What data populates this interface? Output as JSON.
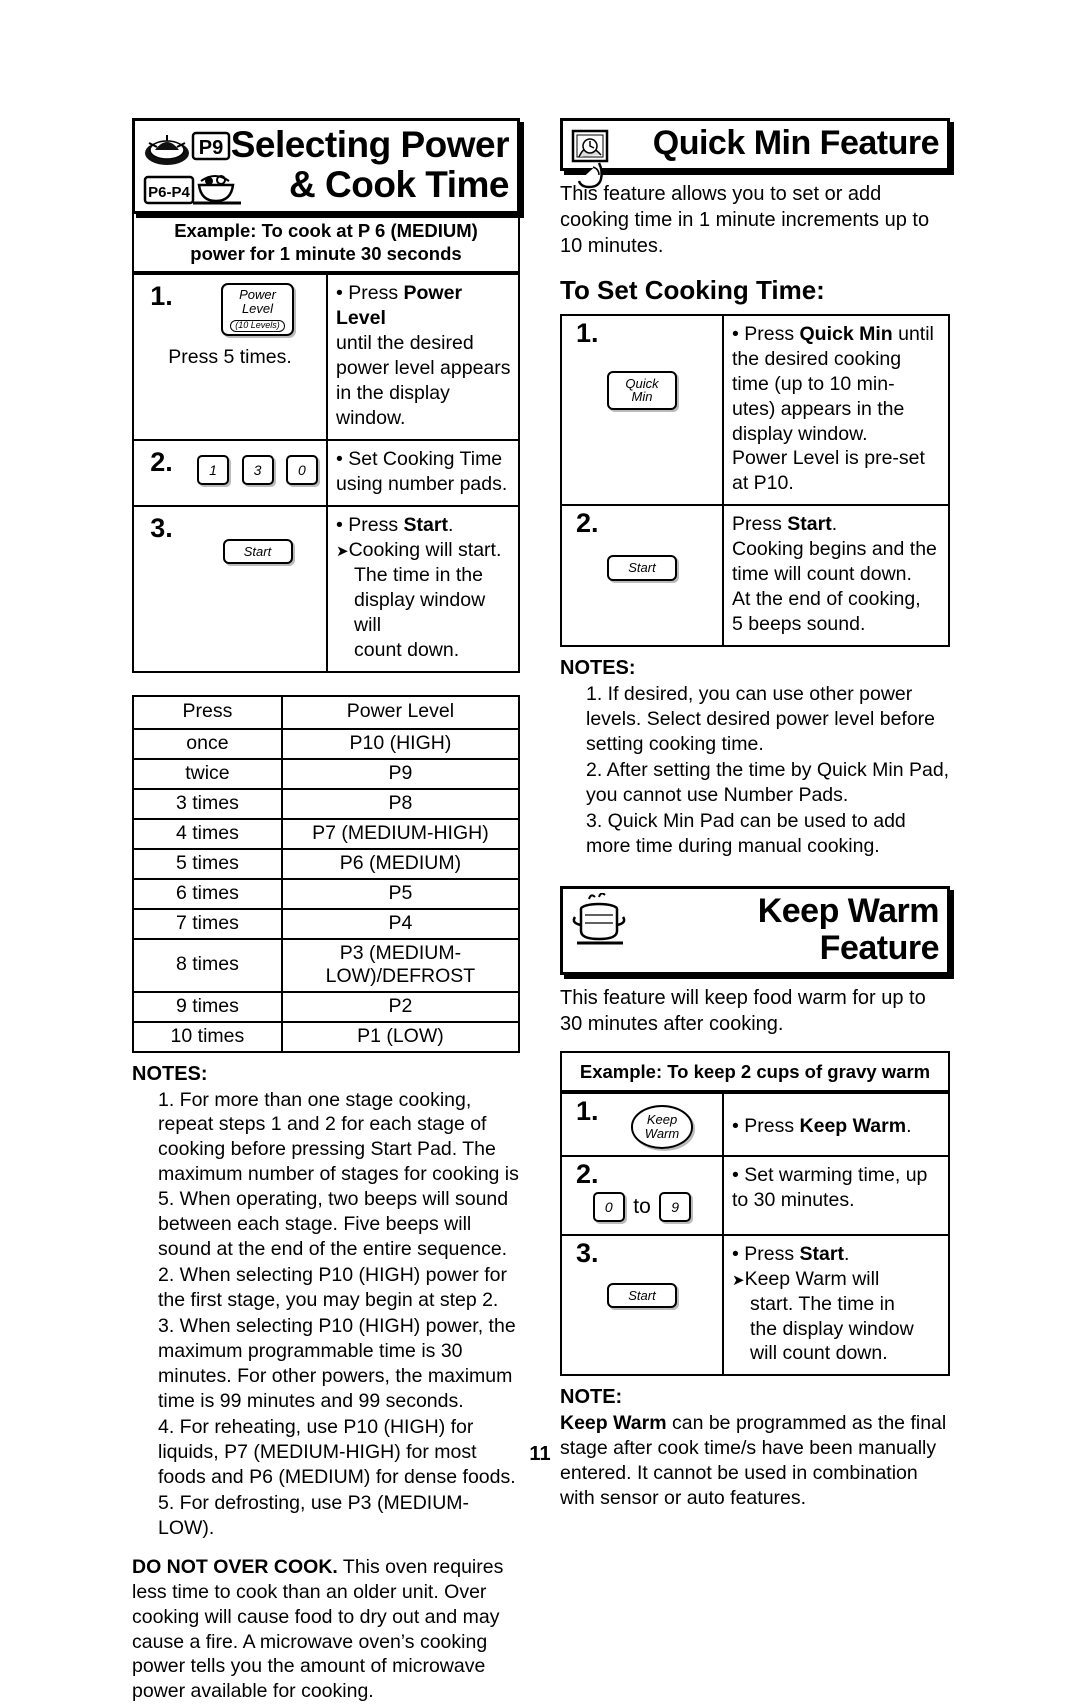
{
  "page_number": "11",
  "left": {
    "banner": {
      "line1": "Selecting Power",
      "line2": "& Cook Time",
      "icon_label_top": "P9",
      "icon_label_bottom": "P6-P4"
    },
    "example_header_line1": "Example: To cook at P 6 (MEDIUM)",
    "example_header_line2": "power for 1 minute 30 seconds",
    "steps": [
      {
        "number": "1.",
        "pad": {
          "kind": "power-level",
          "line1": "Power",
          "line2": "Level",
          "sub": "(10 Levels)"
        },
        "pad_caption": "Press 5 times.",
        "text": [
          {
            "style": "bullet",
            "parts": [
              "Press ",
              "Power Level"
            ]
          },
          {
            "style": "plain",
            "text": "until the desired"
          },
          {
            "style": "plain",
            "text": "power level appears"
          },
          {
            "style": "plain",
            "text": "in the display window."
          }
        ]
      },
      {
        "number": "2.",
        "pad": {
          "kind": "number-pads",
          "keys": [
            "1",
            "3",
            "0"
          ]
        },
        "text": [
          {
            "style": "bullet",
            "text": "Set Cooking Time"
          },
          {
            "style": "plain",
            "text": "using number pads."
          }
        ]
      },
      {
        "number": "3.",
        "pad": {
          "kind": "start",
          "label": "Start"
        },
        "text": [
          {
            "style": "bullet",
            "parts": [
              "Press ",
              "Start",
              "."
            ]
          },
          {
            "style": "arrow",
            "text": "Cooking will start."
          },
          {
            "style": "indent",
            "text": "The time in the"
          },
          {
            "style": "indent",
            "text": "display window will"
          },
          {
            "style": "indent",
            "text": "count down."
          }
        ]
      }
    ],
    "power_table": {
      "headers": [
        "Press",
        "Power Level"
      ],
      "rows": [
        [
          "once",
          "P10 (HIGH)"
        ],
        [
          "twice",
          "P9"
        ],
        [
          "3 times",
          "P8"
        ],
        [
          "4 times",
          "P7 (MEDIUM-HIGH)"
        ],
        [
          "5 times",
          "P6 (MEDIUM)"
        ],
        [
          "6 times",
          "P5"
        ],
        [
          "7 times",
          "P4"
        ],
        [
          "8 times",
          "P3 (MEDIUM-LOW)/DEFROST"
        ],
        [
          "9 times",
          "P2"
        ],
        [
          "10 times",
          "P1 (LOW)"
        ]
      ]
    },
    "notes_head": "NOTES:",
    "notes": [
      "1. For more than one stage cooking, repeat steps 1 and 2 for each stage of cooking before pressing Start Pad. The maximum number of stages for cooking is 5. When operating, two beeps will sound between each stage. Five beeps will sound at the end of the entire sequence.",
      "2. When selecting P10 (HIGH) power for the first stage, you may begin at step 2.",
      "3. When selecting P10 (HIGH) power, the maximum programmable time is 30 minutes. For other powers, the maximum time is 99 minutes and 99 seconds.",
      "4. For reheating, use P10 (HIGH) for liquids, P7 (MEDIUM-HIGH) for most foods and P6 (MEDIUM) for dense foods.",
      "5. For defrosting, use P3 (MEDIUM-LOW)."
    ],
    "warning_bold": "DO NOT OVER COOK.",
    "warning_rest": " This oven requires less time to cook than an older unit. Over cooking will cause food to dry out and may cause a fire. A microwave oven’s cooking power tells you the amount of microwave power available for cooking."
  },
  "right": {
    "quick_min": {
      "banner_title": "Quick Min Feature",
      "intro": "This feature allows you to set or add cooking time in 1 minute increments up to 10 minutes.",
      "subhead": "To Set Cooking Time:",
      "steps": [
        {
          "number": "1.",
          "pad": {
            "kind": "quick-min",
            "line1": "Quick",
            "line2": "Min"
          },
          "text": [
            {
              "style": "bullet",
              "parts": [
                "Press ",
                "Quick Min",
                " until"
              ]
            },
            {
              "style": "plain",
              "text": "the desired cooking"
            },
            {
              "style": "plain",
              "text": "time (up to 10 min-"
            },
            {
              "style": "plain",
              "text": "utes) appears in the"
            },
            {
              "style": "plain",
              "text": "display window."
            },
            {
              "style": "plain",
              "text": "Power Level is pre-set"
            },
            {
              "style": "plain",
              "text": "at P10."
            }
          ]
        },
        {
          "number": "2.",
          "pad": {
            "kind": "start",
            "label": "Start"
          },
          "text": [
            {
              "style": "plain",
              "parts": [
                "Press ",
                "Start",
                "."
              ]
            },
            {
              "style": "plain",
              "text": "Cooking begins and the"
            },
            {
              "style": "plain",
              "text": "time will count down."
            },
            {
              "style": "plain",
              "text": "At the end of cooking,"
            },
            {
              "style": "plain",
              "text": "5 beeps sound."
            }
          ]
        }
      ],
      "notes_head": "NOTES:",
      "notes": [
        "1. If desired, you can use other power levels. Select desired power level before setting cooking time.",
        "2. After setting the time by Quick Min Pad, you cannot use Number Pads.",
        "3. Quick Min Pad can be used to add more time during manual cooking."
      ]
    },
    "keep_warm": {
      "banner_title": "Keep Warm Feature",
      "intro": "This feature will keep food warm for up to 30 minutes after cooking.",
      "example_header": "Example: To keep 2 cups of gravy warm",
      "steps": [
        {
          "number": "1.",
          "pad": {
            "kind": "keep-warm",
            "line1": "Keep",
            "line2": "Warm"
          },
          "text": [
            {
              "style": "bullet",
              "parts": [
                "Press ",
                "Keep Warm",
                "."
              ]
            }
          ]
        },
        {
          "number": "2.",
          "pad": {
            "kind": "range",
            "from": "0",
            "to_word": "to",
            "to": "9"
          },
          "text": [
            {
              "style": "bullet",
              "text": "Set warming time, up"
            },
            {
              "style": "plain",
              "text": "to 30 minutes."
            }
          ]
        },
        {
          "number": "3.",
          "pad": {
            "kind": "start",
            "label": "Start"
          },
          "text": [
            {
              "style": "bullet",
              "parts": [
                "Press ",
                "Start",
                "."
              ]
            },
            {
              "style": "arrow",
              "text": "Keep Warm will"
            },
            {
              "style": "indent",
              "text": "start. The time in"
            },
            {
              "style": "indent",
              "text": "the display window"
            },
            {
              "style": "indent",
              "text": "will count down."
            }
          ]
        }
      ],
      "note_head": "NOTE:",
      "note_bold": "Keep Warm",
      "note_rest": " can be programmed as the final stage after cook time/s have been manually entered. It cannot be used in combination with sensor or auto features."
    }
  }
}
